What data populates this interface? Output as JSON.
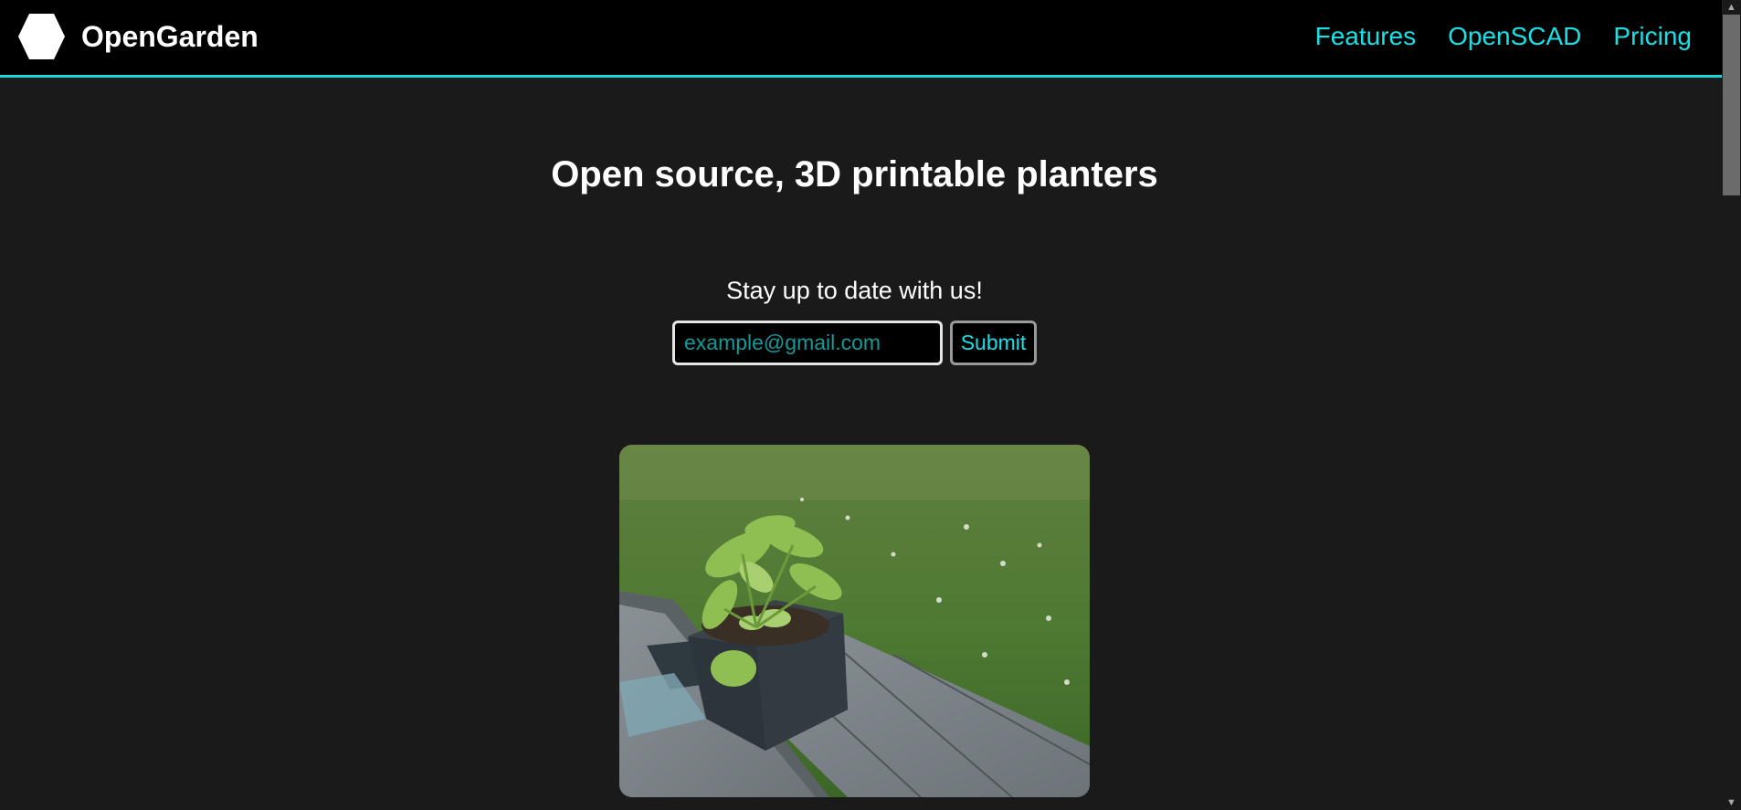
{
  "brand": {
    "name": "OpenGarden",
    "logo_icon": "hexagon-icon"
  },
  "nav": {
    "links": [
      {
        "label": "Features"
      },
      {
        "label": "OpenSCAD"
      },
      {
        "label": "Pricing"
      }
    ]
  },
  "hero": {
    "headline": "Open source, 3D printable planters"
  },
  "subscribe": {
    "label": "Stay up to date with us!",
    "email_placeholder": "example@gmail.com",
    "email_value": "",
    "submit_label": "Submit"
  },
  "colors": {
    "accent": "#1ad6d6",
    "background": "#1a1a1a",
    "nav_background": "#000000"
  },
  "image": {
    "subject": "photo of a plant in a hexagonal 3D printed planter on a deck"
  }
}
